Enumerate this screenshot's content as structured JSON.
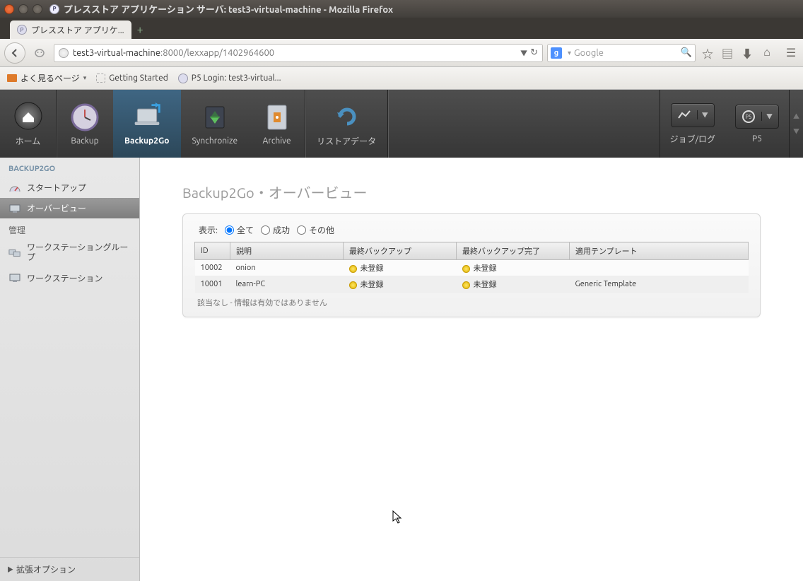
{
  "window": {
    "title": "プレスストア アプリケーション サーバ: test3-virtual-machine - Mozilla Firefox"
  },
  "tab": {
    "title": "プレスストア アプリケ..."
  },
  "url": {
    "host": "test3-virtual-machine",
    "rest": ":8000/lexxapp/1402964600"
  },
  "search": {
    "placeholder": "Google",
    "engine": "g"
  },
  "bookmarks": {
    "freq": "よく見るページ",
    "start": "Getting Started",
    "p5": "P5 Login: test3-virtual..."
  },
  "appnav": {
    "home": "ホーム",
    "backup": "Backup",
    "backup2go": "Backup2Go",
    "synchronize": "Synchronize",
    "archive": "Archive",
    "restore": "リストアデータ",
    "jobs": "ジョブ/ログ",
    "p5": "P5"
  },
  "sidebar": {
    "section": "BACKUP2GO",
    "startup": "スタートアップ",
    "overview": "オーバービュー",
    "manage": "管理",
    "wsgroup": "ワークステーショングループ",
    "ws": "ワークステーション",
    "expand": "拡張オプション"
  },
  "page": {
    "title": "Backup2Go・オーバービュー",
    "filter_label": "表示:",
    "filters": {
      "all": "全て",
      "ok": "成功",
      "other": "その他"
    },
    "cols": {
      "id": "ID",
      "desc": "説明",
      "last": "最終バックアップ",
      "done": "最終バックアップ完了",
      "tmpl": "適用テンプレート"
    },
    "rows": [
      {
        "id": "10002",
        "desc": "onion",
        "last": "未登録",
        "done": "未登録",
        "tmpl": ""
      },
      {
        "id": "10001",
        "desc": "learn-PC",
        "last": "未登録",
        "done": "未登録",
        "tmpl": "Generic Template"
      }
    ],
    "footnote": "該当なし - 情報は有効ではありません"
  }
}
